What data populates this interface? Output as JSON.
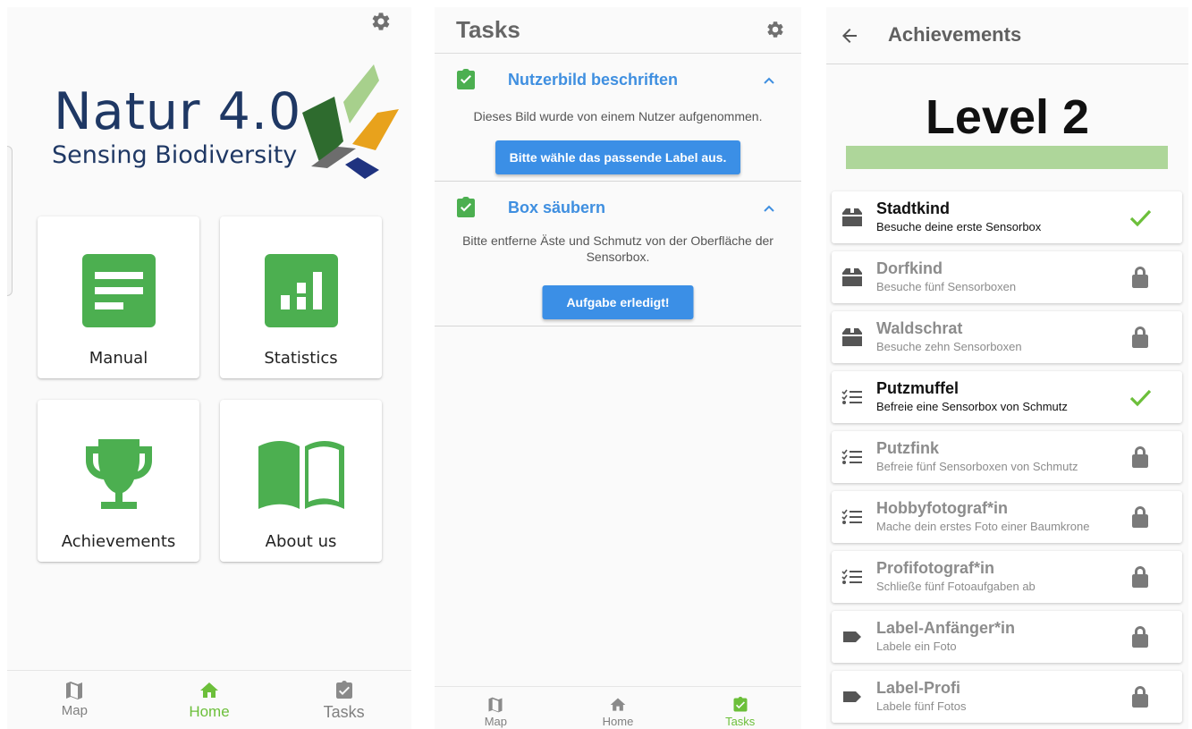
{
  "colors": {
    "green": "#4caf50",
    "active_nav": "#6cbf3a",
    "task_title": "#3f8fe0",
    "button_blue": "#3b8fe6",
    "logo_navy": "#1f3864",
    "level_bar": "#aed69a"
  },
  "home": {
    "logo": {
      "title": "Natur 4.0",
      "subtitle": "Sensing Biodiversity"
    },
    "settings_icon": "gear-icon",
    "cards": [
      {
        "label": "Manual",
        "icon": "document-icon"
      },
      {
        "label": "Statistics",
        "icon": "bar-chart-icon"
      },
      {
        "label": "Achievements",
        "icon": "trophy-icon"
      },
      {
        "label": "About us",
        "icon": "book-icon"
      }
    ],
    "nav": [
      {
        "label": "Map",
        "icon": "map-icon",
        "active": false
      },
      {
        "label": "Home",
        "icon": "home-icon",
        "active": true
      },
      {
        "label": "Tasks",
        "icon": "task-icon",
        "active": false
      }
    ]
  },
  "tasks": {
    "title": "Tasks",
    "items": [
      {
        "title": "Nutzerbild beschriften",
        "description": "Dieses Bild wurde von einem Nutzer aufgenommen.",
        "button": "Bitte wähle das passende Label aus."
      },
      {
        "title": "Box säubern",
        "description": "Bitte entferne Äste und Schmutz von der Oberfläche der Sensorbox.",
        "button": "Aufgabe erledigt!"
      }
    ],
    "nav": [
      {
        "label": "Map",
        "icon": "map-icon",
        "active": false
      },
      {
        "label": "Home",
        "icon": "home-icon",
        "active": false
      },
      {
        "label": "Tasks",
        "icon": "task-icon",
        "active": true
      }
    ]
  },
  "achievements": {
    "title": "Achievements",
    "level": "Level 2",
    "level_progress": 1.0,
    "items": [
      {
        "name": "Stadtkind",
        "description": "Besuche deine erste Sensorbox",
        "icon": "box-icon",
        "unlocked": true
      },
      {
        "name": "Dorfkind",
        "description": "Besuche fünf Sensorboxen",
        "icon": "box-icon",
        "unlocked": false
      },
      {
        "name": "Waldschrat",
        "description": "Besuche zehn Sensorboxen",
        "icon": "box-icon",
        "unlocked": false
      },
      {
        "name": "Putzmuffel",
        "description": "Befreie eine Sensorbox von Schmutz",
        "icon": "checklist-icon",
        "unlocked": true
      },
      {
        "name": "Putzfink",
        "description": "Befreie fünf Sensorboxen von Schmutz",
        "icon": "checklist-icon",
        "unlocked": false
      },
      {
        "name": "Hobbyfotograf*in",
        "description": "Mache dein erstes Foto einer Baumkrone",
        "icon": "checklist-icon",
        "unlocked": false
      },
      {
        "name": "Profifotograf*in",
        "description": "Schließe fünf Fotoaufgaben ab",
        "icon": "checklist-icon",
        "unlocked": false
      },
      {
        "name": "Label-Anfänger*in",
        "description": "Labele ein Foto",
        "icon": "label-icon",
        "unlocked": false
      },
      {
        "name": "Label-Profi",
        "description": "Labele fünf Fotos",
        "icon": "label-icon",
        "unlocked": false
      }
    ]
  }
}
